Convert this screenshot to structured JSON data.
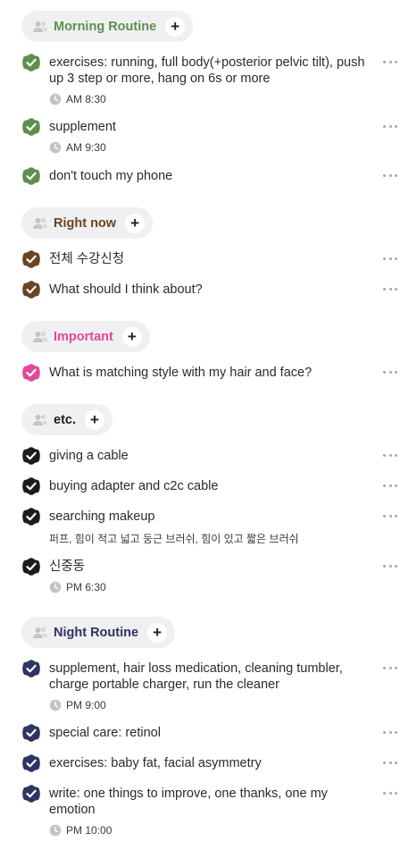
{
  "colors": {
    "morning": "#5e8f4c",
    "right_now": "#6b4423",
    "important": "#e4479a",
    "etc": "#1c1c1c",
    "night": "#2e3463",
    "chip_bg": "#f0f0f2",
    "muted_icon": "#c4c4c6"
  },
  "groups": [
    {
      "title": "Morning Routine",
      "tasks": [
        {
          "text": "exercises: running, full body(+posterior pelvic tilt), push up 3 step or more, hang on 6s or more",
          "time": "AM 8:30"
        },
        {
          "text": "supplement",
          "time": "AM 9:30"
        },
        {
          "text": "don't touch my phone"
        }
      ]
    },
    {
      "title": "Right now",
      "tasks": [
        {
          "text": "전체 수강신청"
        },
        {
          "text": "What should I think about?"
        }
      ]
    },
    {
      "title": "Important",
      "tasks": [
        {
          "text": "What is matching style with my hair and face?"
        }
      ]
    },
    {
      "title": "etc.",
      "tasks": [
        {
          "text": "giving a cable"
        },
        {
          "text": "buying adapter and c2c cable"
        },
        {
          "text": "searching makeup",
          "note": "퍼프, 힘이 적고 넓고 둥근 브러쉬, 힘이 있고 짧은 브러쉬"
        },
        {
          "text": "신중동",
          "time": "PM 6:30"
        }
      ]
    },
    {
      "title": "Night Routine",
      "tasks": [
        {
          "text": "supplement, hair loss medication, cleaning tumbler, charge portable charger, run the cleaner",
          "time": "PM 9:00"
        },
        {
          "text": "special care: retinol"
        },
        {
          "text": "exercises: baby fat, facial asymmetry"
        },
        {
          "text": "write: one things to improve, one thanks, one my emotion",
          "time": "PM 10:00"
        }
      ]
    }
  ]
}
